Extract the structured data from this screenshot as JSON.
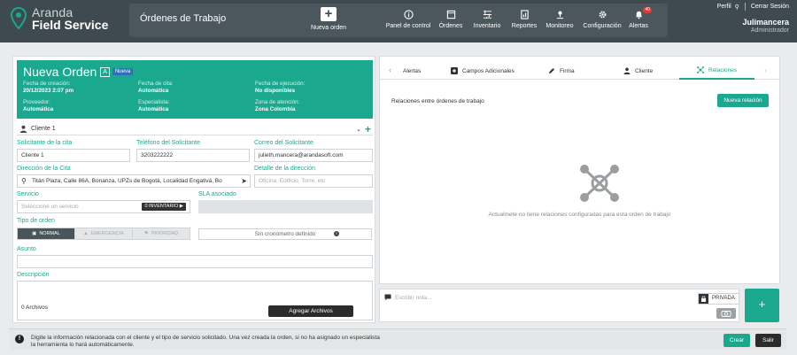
{
  "brand": {
    "line1": "Aranda",
    "line2": "Field Service"
  },
  "header": {
    "page_title": "Órdenes de Trabajo",
    "new_order_label": "Nueva orden",
    "nav": [
      {
        "label": "Panel de control",
        "icon": "info-icon"
      },
      {
        "label": "Órdenes",
        "icon": "orders-icon"
      },
      {
        "label": "Inventario",
        "icon": "inventory-icon"
      },
      {
        "label": "Reportes",
        "icon": "reports-icon"
      },
      {
        "label": "Monitoreo",
        "icon": "monitor-icon"
      },
      {
        "label": "Configuración",
        "icon": "gear-icon"
      },
      {
        "label": "Alertas",
        "icon": "bell-icon",
        "badge": "40"
      }
    ],
    "profile_label": "Perfil",
    "logout_label": "Cerrar Sesión",
    "username": "Julimancera",
    "role": "Administrador"
  },
  "order": {
    "title": "Nueva Orden",
    "chip_letter": "A",
    "chip_status": "Nueva",
    "fields": {
      "fecha_creacion": {
        "label": "Fecha de creación:",
        "value": "20/12/2023 2:07 pm"
      },
      "fecha_cita": {
        "label": "Fecha de cita:",
        "value": "Automática"
      },
      "fecha_ejecucion": {
        "label": "Fecha de ejecución:",
        "value": "No disponibles"
      },
      "proveedor": {
        "label": "Proveedor:",
        "value": "Automática"
      },
      "especialista": {
        "label": "Especialista:",
        "value": "Automática"
      },
      "zona": {
        "label": "Zona de atención:",
        "value": "Zona Colombia"
      }
    }
  },
  "form": {
    "cliente": "Cliente 1",
    "solicitante_label": "Solicitante de la cita",
    "solicitante_value": "Cliente 1",
    "telefono_label": "Teléfono del Solicitante",
    "telefono_value": "3203222222",
    "correo_label": "Correo del Solicitante",
    "correo_value": "julieth.mancera@arandasoft.com",
    "direccion_label": "Dirección de la Cita",
    "direccion_value": "Titán Plaza, Calle 86A, Bonanza, UPZs de Bogotá, Localidad Engativá, Bo",
    "detalle_label": "Detalle de la dirección",
    "detalle_placeholder": "Oficina, Edificio, Torre, etc",
    "servicio_label": "Servicio",
    "servicio_placeholder": "Seleccione un servicio",
    "inventario_btn": "0 INVENTARIO ▶",
    "sla_label": "SLA asociado",
    "tipo_label": "Tipo de orden",
    "tipos": [
      "NORMAL",
      "EMERGENCIA",
      "PRIORIDAD"
    ],
    "cronometro": "Sin cronómetro definido",
    "asunto_label": "Asunto",
    "descripcion_label": "Descripción",
    "archivos": "0 Archivos",
    "agregar_archivos": "Agregar Archivos"
  },
  "tabs": [
    {
      "label": "Alertas",
      "icon": "chevron-left-icon"
    },
    {
      "label": "Campos Adicionales",
      "icon": "plus-square-icon"
    },
    {
      "label": "Firma",
      "icon": "pen-icon"
    },
    {
      "label": "Cliente",
      "icon": "user-icon"
    },
    {
      "label": "Relaciones",
      "icon": "network-icon",
      "active": true
    }
  ],
  "relations": {
    "title": "Relaciones entre órdenes de trabajo",
    "new_button": "Nueva relación",
    "empty_message": "Actualmete no tiene relaciones configuradas para esta orden de trabajo"
  },
  "note": {
    "placeholder": "Escribir nota...",
    "private_label": "PRIVADA"
  },
  "footer": {
    "message": "Digite la información relacionada con el cliente y el tipo de servicio solicitado. Una vez creada la orden, si no ha asignado un especialista la herramienta lo hará automáticamente.",
    "create_label": "Crear",
    "exit_label": "Salir"
  },
  "colors": {
    "accent": "#1aa98f",
    "topbar": "#3e4a50",
    "badge": "#e53935"
  }
}
